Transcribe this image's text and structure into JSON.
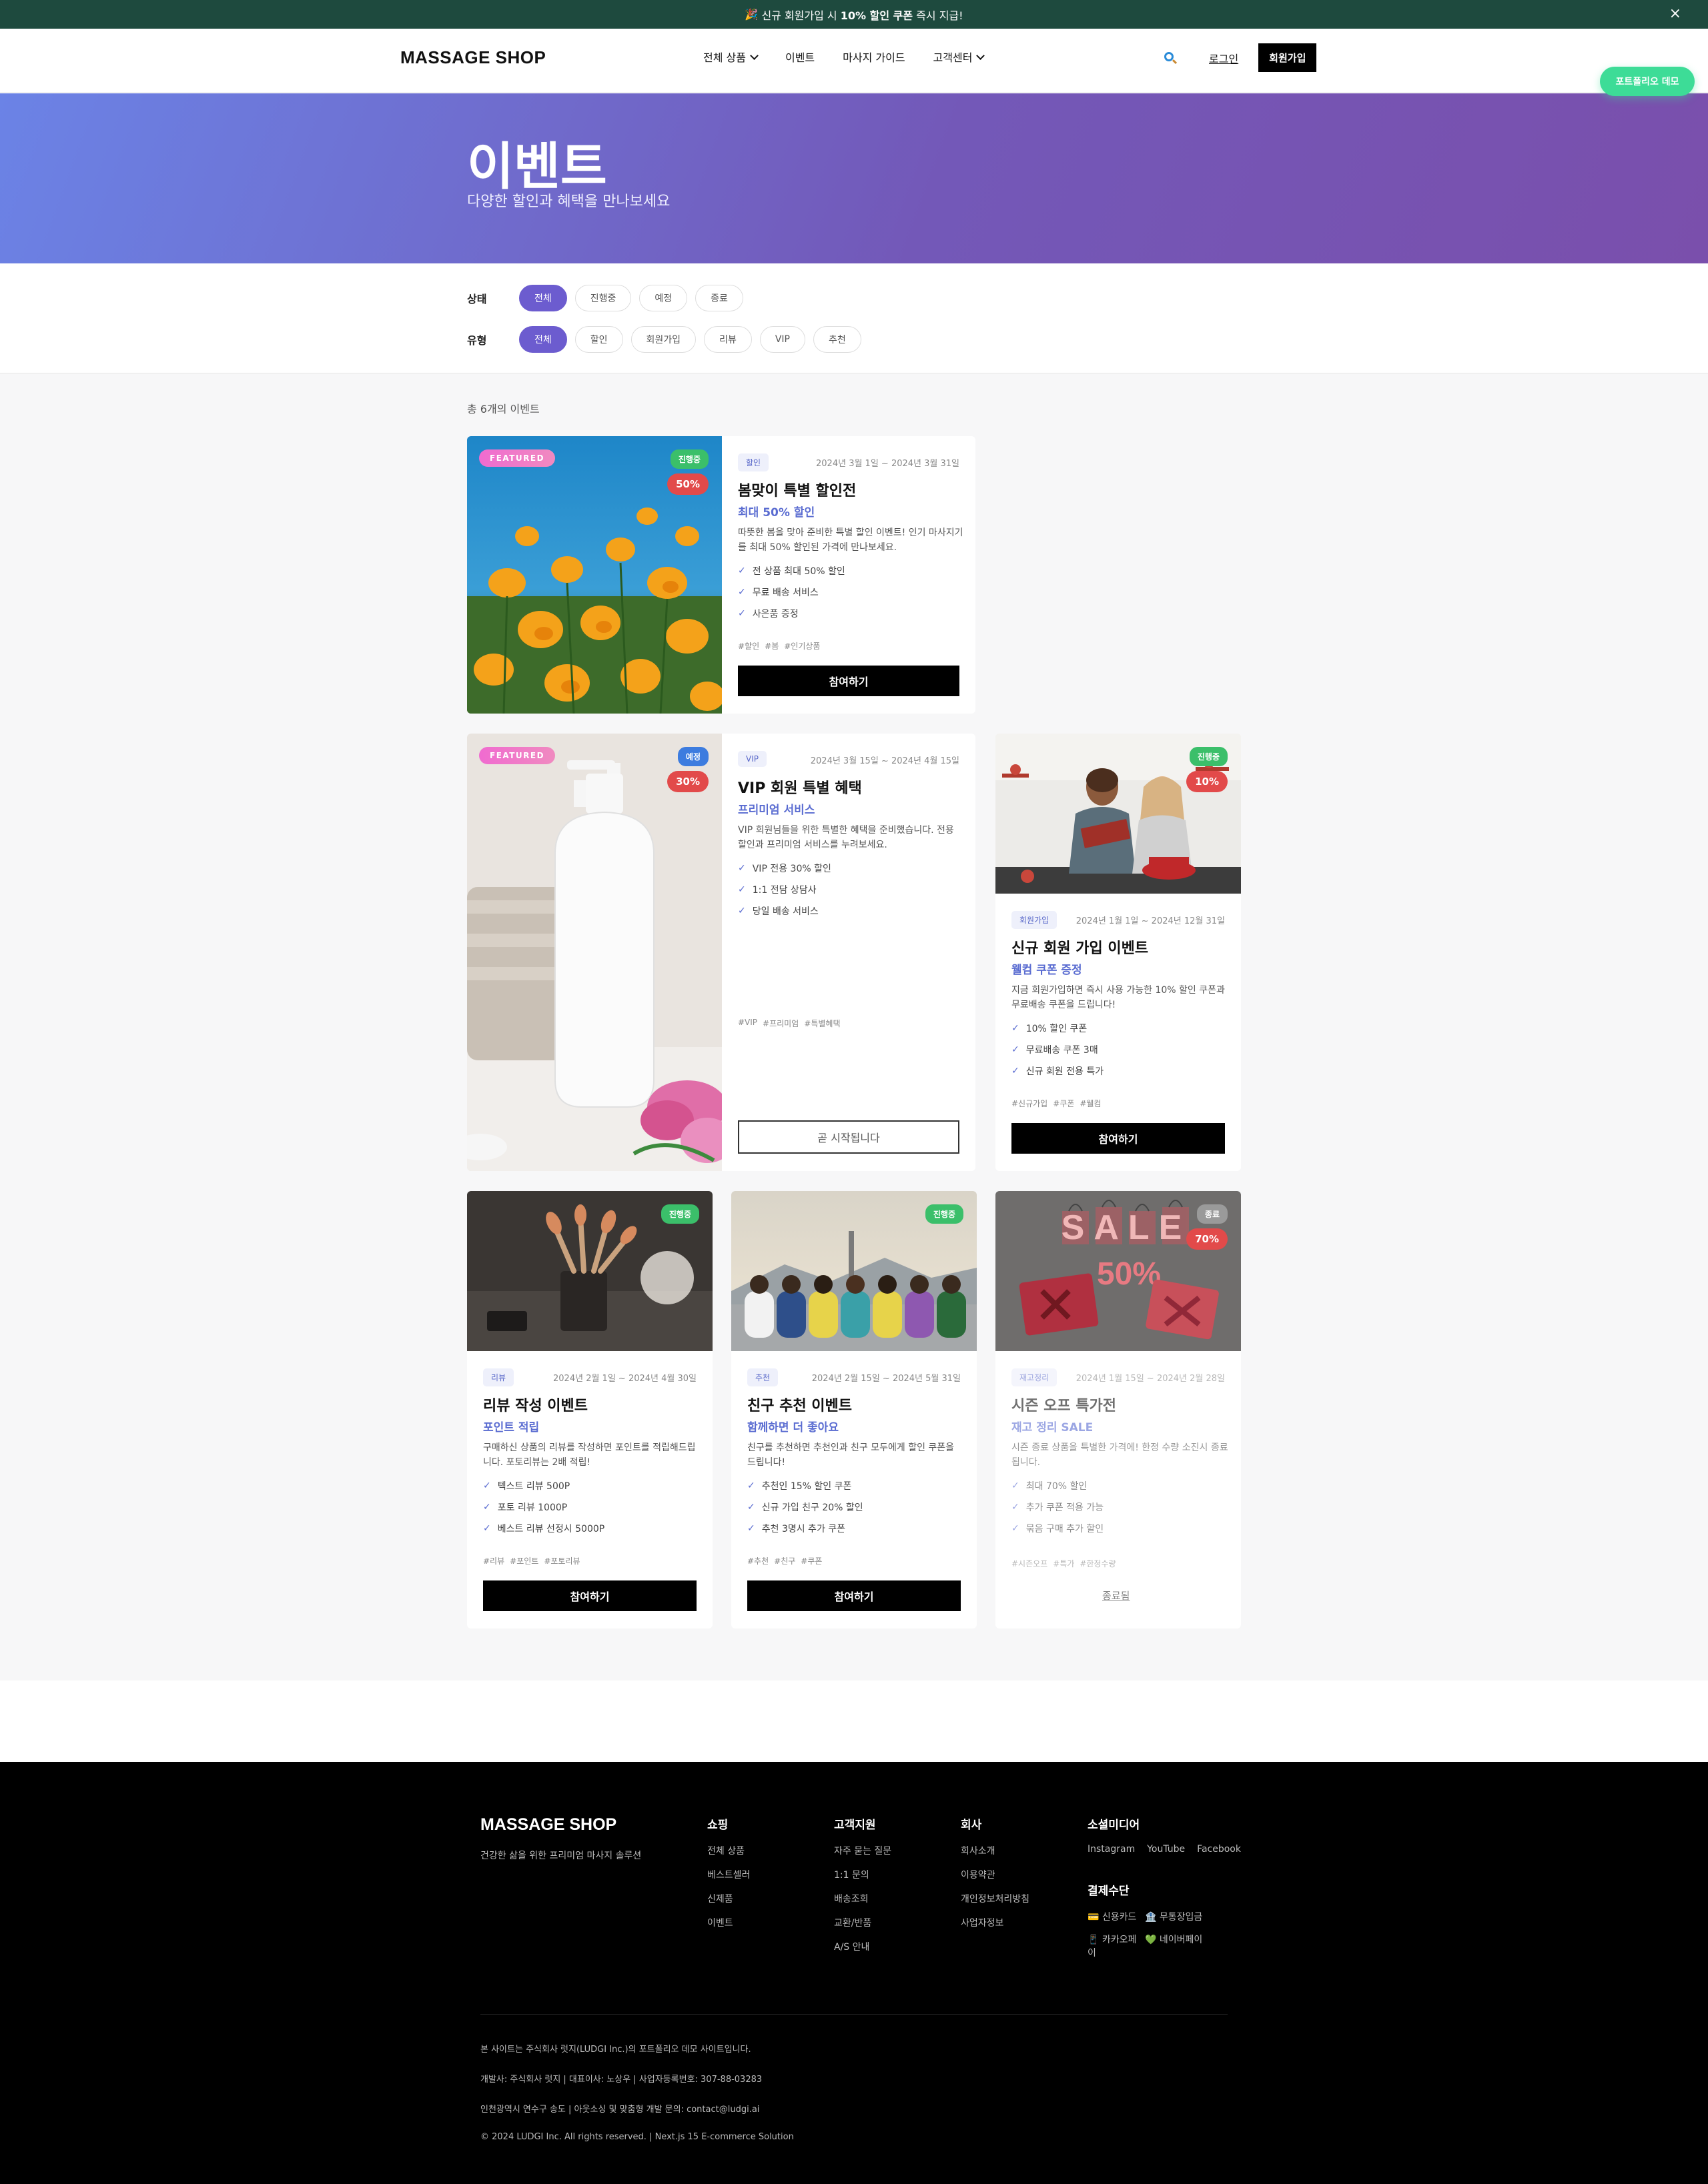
{
  "announcement": {
    "icon": "🎉",
    "pre": "신규 회원가입 시",
    "bold": "10% 할인 쿠폰",
    "post": "즉시 지급!",
    "close": "×"
  },
  "header": {
    "logo": "MASSAGE SHOP",
    "nav": [
      {
        "label": "전체 상품"
      },
      {
        "label": "이벤트"
      },
      {
        "label": "마사지 가이드"
      },
      {
        "label": "고객센터"
      }
    ],
    "login": "로그인",
    "signup": "회원가입",
    "portfolio": "포트폴리오 데모"
  },
  "hero": {
    "title": "이벤트",
    "subtitle": "다양한 할인과 혜택을 만나보세요"
  },
  "filters": {
    "status_label": "상태",
    "status": [
      "전체",
      "진행중",
      "예정",
      "종료"
    ],
    "type_label": "유형",
    "type": [
      "전체",
      "할인",
      "회원가입",
      "리뷰",
      "VIP",
      "추천"
    ]
  },
  "total_text": "총 6개의 이벤트",
  "events": [
    {
      "featured": "FEATURED",
      "status": "진행중",
      "discount": "50%",
      "tag": "할인",
      "period": "2024년 3월 1일 ~ 2024년 3월 31일",
      "title": "봄맞이 특별 할인전",
      "subtitle": "최대 50% 할인",
      "desc1": "따뜻한 봄을 맞아 준비한 특별 할인 이벤트! 인기 마사지기",
      "desc2": "를 최대 50% 할인된 가격에 만나보세요.",
      "benefits": [
        "전 상품 최대 50% 할인",
        "무료 배송 서비스",
        "사은품 증정"
      ],
      "hashtags": [
        "#할인",
        "#봄",
        "#인기상품"
      ],
      "button": "참여하기"
    },
    {
      "featured": "FEATURED",
      "status": "예정",
      "discount": "30%",
      "tag": "VIP",
      "period": "2024년 3월 15일 ~ 2024년 4월 15일",
      "title": "VIP 회원 특별 혜택",
      "subtitle": "프리미엄 서비스",
      "desc1": "VIP 회원님들을 위한 특별한 혜택을 준비했습니다. 전용",
      "desc2": "할인과 프리미엄 서비스를 누려보세요.",
      "benefits": [
        "VIP 전용 30% 할인",
        "1:1 전담 상담사",
        "당일 배송 서비스"
      ],
      "hashtags": [
        "#VIP",
        "#프리미엄",
        "#특별혜택"
      ],
      "button": "곧 시작됩니다"
    },
    {
      "status": "진행중",
      "discount": "10%",
      "tag": "회원가입",
      "period": "2024년 1월 1일 ~ 2024년 12월 31일",
      "title": "신규 회원 가입 이벤트",
      "subtitle": "웰컴 쿠폰 증정",
      "desc1": "지금 회원가입하면 즉시 사용 가능한 10% 할인 쿠폰과",
      "desc2": "무료배송 쿠폰을 드립니다!",
      "benefits": [
        "10% 할인 쿠폰",
        "무료배송 쿠폰 3매",
        "신규 회원 전용 특가"
      ],
      "hashtags": [
        "#신규가입",
        "#쿠폰",
        "#웰컴"
      ],
      "button": "참여하기"
    },
    {
      "status": "진행중",
      "tag": "리뷰",
      "period": "2024년 2월 1일 ~ 2024년 4월 30일",
      "title": "리뷰 작성 이벤트",
      "subtitle": "포인트 적립",
      "desc1": "구매하신 상품의 리뷰를 작성하면 포인트를 적립해드립",
      "desc2": "니다. 포토리뷰는 2배 적립!",
      "benefits": [
        "텍스트 리뷰 500P",
        "포토 리뷰 1000P",
        "베스트 리뷰 선정시 5000P"
      ],
      "hashtags": [
        "#리뷰",
        "#포인트",
        "#포토리뷰"
      ],
      "button": "참여하기"
    },
    {
      "status": "진행중",
      "tag": "추천",
      "period": "2024년 2월 15일 ~ 2024년 5월 31일",
      "title": "친구 추천 이벤트",
      "subtitle": "함께하면 더 좋아요",
      "desc1": "친구를 추천하면 추천인과 친구 모두에게 할인 쿠폰을",
      "desc2": "드립니다!",
      "benefits": [
        "추천인 15% 할인 쿠폰",
        "신규 가입 친구 20% 할인",
        "추천 3명시 추가 쿠폰"
      ],
      "hashtags": [
        "#추천",
        "#친구",
        "#쿠폰"
      ],
      "button": "참여하기"
    },
    {
      "status": "종료",
      "discount": "70%",
      "tag": "재고정리",
      "period": "2024년 1월 15일 ~ 2024년 2월 28일",
      "title": "시즌 오프 특가전",
      "subtitle": "재고 정리 SALE",
      "desc1": "시즌 종료 상품을 특별한 가격에! 한정 수량 소진시 종료",
      "desc2": "됩니다.",
      "benefits": [
        "최대 70% 할인",
        "추가 쿠폰 적용 가능",
        "묶음 구매 추가 할인"
      ],
      "hashtags": [
        "#시즌오프",
        "#특가",
        "#한정수량"
      ],
      "button": "종료됨",
      "image_text_1": "SALE",
      "image_text_2": "50%"
    }
  ],
  "footer": {
    "logo": "MASSAGE SHOP",
    "tagline": "건강한 삶을 위한 프리미엄 마사지 솔루션",
    "cols": [
      {
        "title": "쇼핑",
        "links": [
          "전체 상품",
          "베스트셀러",
          "신제품",
          "이벤트"
        ]
      },
      {
        "title": "고객지원",
        "links": [
          "자주 묻는 질문",
          "1:1 문의",
          "배송조회",
          "교환/반품",
          "A/S 안내"
        ]
      },
      {
        "title": "회사",
        "links": [
          "회사소개",
          "이용약관",
          "개인정보처리방침",
          "사업자정보"
        ]
      }
    ],
    "social_title": "소셜미디어",
    "social": [
      "Instagram",
      "YouTube",
      "Facebook"
    ],
    "pay_title": "결제수단",
    "pay": [
      "💳 신용카드",
      "🏦 무통장입금",
      "📱 카카오페이",
      "💚 네이버페이"
    ],
    "info": [
      "본 사이트는 주식회사 럿지(LUDGI Inc.)의 포트폴리오 데모 사이트입니다.",
      "개발사: 주식회사 럿지 | 대표이사: 노상우 | 사업자등록번호: 307-88-03283",
      "인천광역시 연수구 송도 | 아웃소싱 및 맞춤형 개발 문의: contact@ludgi.ai",
      "© 2024 LUDGI Inc. All rights reserved. | Next.js 15 E-commerce Solution"
    ]
  }
}
